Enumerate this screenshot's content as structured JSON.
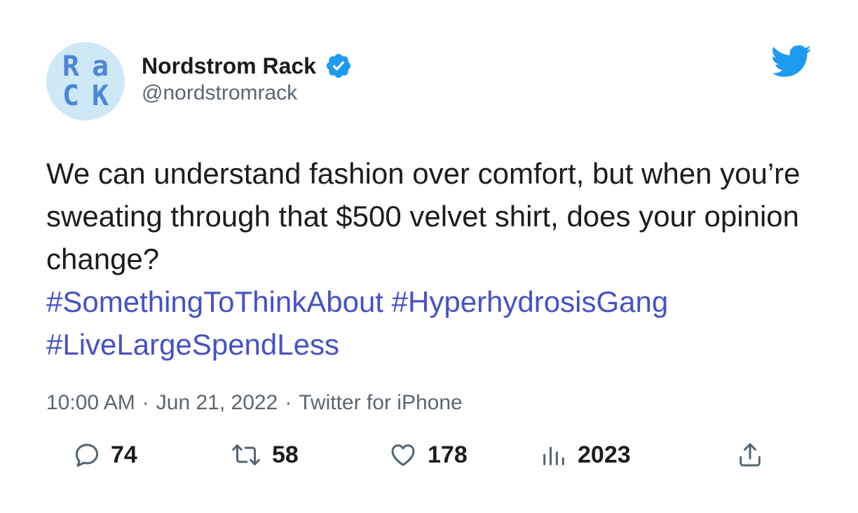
{
  "tweet": {
    "avatar": {
      "logo_letters": [
        "R",
        "a",
        "C",
        "K"
      ],
      "bg_color": "#cfe8f6",
      "logo_color": "#4a86d9"
    },
    "author": {
      "display_name": "Nordstrom Rack",
      "handle": "@nordstromrack",
      "verified": true
    },
    "text": "We can understand fashion over comfort, but when you’re sweating through that $500 velvet shirt, does your opinion change?",
    "hashtags": [
      "#SomethingToThinkAbout",
      "#HyperhydrosisGang",
      "#LiveLargeSpendLess"
    ],
    "meta": {
      "time": "10:00 AM",
      "separator": "·",
      "date": "Jun 21, 2022",
      "source": "Twitter for iPhone"
    },
    "actions": {
      "replies": "74",
      "retweets": "58",
      "likes": "178",
      "views": "2023"
    },
    "icons": {
      "verified": "verified-badge-icon",
      "brand": "twitter-bird-icon",
      "reply": "speech-bubble-icon",
      "retweet": "retweet-arrows-icon",
      "like": "heart-icon",
      "views": "bar-chart-icon",
      "share": "share-upload-icon"
    },
    "colors": {
      "link": "#4651c6",
      "twitter_blue": "#1d9bf0",
      "secondary_text": "#5b6670",
      "icon_gray": "#536471"
    }
  }
}
